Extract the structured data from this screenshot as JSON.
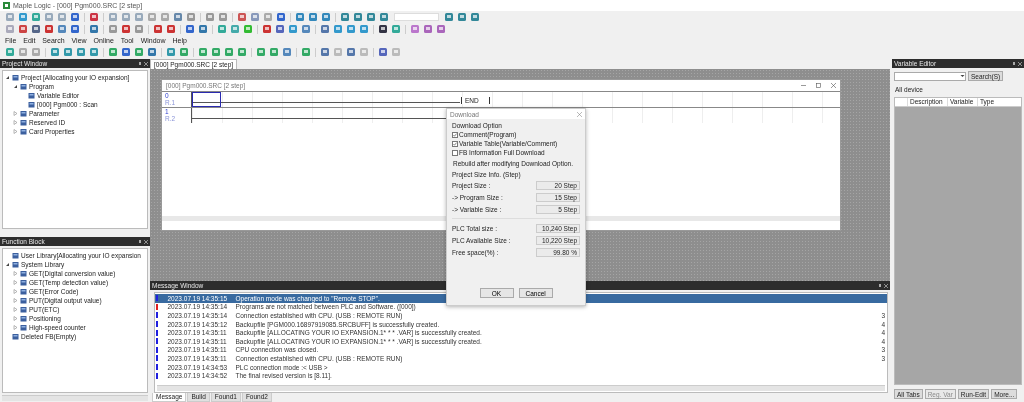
{
  "window": {
    "title": "Maple Logic - [000] Pgm000.SRC [2 step]"
  },
  "menu": [
    "File",
    "Edit",
    "Search",
    "View",
    "Online",
    "Tool",
    "Window",
    "Help"
  ],
  "project_window": {
    "title": "Project Window",
    "tree": [
      {
        "label": "Project [Allocating your IO expansion]",
        "expanded": true,
        "children": [
          {
            "label": "Program",
            "expanded": true,
            "children": [
              {
                "label": "Variable Editor"
              },
              {
                "label": "[000] Pgm000 : Scan"
              }
            ]
          },
          {
            "label": "Parameter",
            "expanded": false
          },
          {
            "label": "Reserved ID",
            "expanded": false
          },
          {
            "label": "Card Properties",
            "expanded": false
          }
        ]
      }
    ]
  },
  "function_block": {
    "title": "Function Block",
    "tree": [
      {
        "label": "User Library[Allocating your IO expansion"
      },
      {
        "label": "System Library",
        "expanded": true,
        "children": [
          {
            "label": "GET(Digital conversion value)",
            "expanded": false
          },
          {
            "label": "GET(Temp detection value)",
            "expanded": false
          },
          {
            "label": "GET(Error Code)",
            "expanded": false
          },
          {
            "label": "PUT(Digital output value)",
            "expanded": false
          },
          {
            "label": "PUT(ETC)",
            "expanded": false
          },
          {
            "label": "Positioning",
            "expanded": false
          },
          {
            "label": "High-speed counter",
            "expanded": false
          }
        ]
      },
      {
        "label": "Deleted FB(Empty)"
      }
    ]
  },
  "editor_tabs": [
    {
      "label": "[000] Pgm000.SRC [2 step]",
      "selected": true
    }
  ],
  "program_window": {
    "title": "[000] Pgm000.SRC [2 step]",
    "rungs": [
      {
        "step": "0",
        "label": "R.1"
      },
      {
        "step": "1",
        "label": "R.2"
      }
    ],
    "end_label": "END"
  },
  "download_dialog": {
    "title": "Download",
    "option_group": "Download Option",
    "options": [
      {
        "label": "Comment(Program)",
        "checked": true
      },
      {
        "label": "Variable Table(Variable/Comment)",
        "checked": true
      },
      {
        "label": "FB Information Full Download",
        "checked": false
      }
    ],
    "note": "Rebuild after modifying Download Option.",
    "size_group": "Project Size Info. (Step)",
    "sizes": [
      {
        "label": "Project Size :",
        "value": "20 Step"
      },
      {
        "label": "-> Program Size :",
        "value": "15 Step"
      },
      {
        "label": "-> Variable Size :",
        "value": "5 Step"
      }
    ],
    "plc_sizes": [
      {
        "label": "PLC Total size :",
        "value": "10,240 Step"
      },
      {
        "label": "PLC Available Size :",
        "value": "10,220 Step"
      },
      {
        "label": "Free space(%) :",
        "value": "99.80 %"
      }
    ],
    "buttons": [
      "OK",
      "Cancel"
    ]
  },
  "message_window": {
    "title": "Message Window",
    "messages": [
      {
        "time": "2023.07.19 14:35:15",
        "text": "Operation mode was changed to \"Remote STOP\".",
        "color": "#2020e0",
        "selected": true
      },
      {
        "time": "2023.07.19 14:35:14",
        "text": "Programs are not matched between PLC and Software. ([000])",
        "color": "#e02020",
        "selected": false
      },
      {
        "time": "2023.07.19 14:35:14",
        "text": "Connection established with CPU. (USB : REMOTE RUN)",
        "color": "#2020e0",
        "selected": false,
        "column_3": "3"
      },
      {
        "time": "2023.07.19 14:35:12",
        "text": "Backupfile [PGM000.16897919085.SRCBUFF] is successfully created.",
        "color": "#2020e0",
        "selected": false,
        "column_3": "4"
      },
      {
        "time": "2023.07.19 14:35:11",
        "text": "Backupfile [ALLOCATING YOUR IO EXPANSION.1* * * .VAR] is successfully created.",
        "color": "#2020e0",
        "selected": false,
        "column_3": "4"
      },
      {
        "time": "2023.07.19 14:35:11",
        "text": "Backupfile [ALLOCATING YOUR IO EXPANSION.1* * * .VAR] is successfully created.",
        "color": "#2020e0",
        "selected": false,
        "column_3": "4"
      },
      {
        "time": "2023.07.19 14:35:11",
        "text": "CPU connection was closed.",
        "color": "#2020e0",
        "selected": false,
        "column_3": "3"
      },
      {
        "time": "2023.07.19 14:35:11",
        "text": "Connection established with CPU. (USB : REMOTE RUN)",
        "color": "#2020e0",
        "selected": false,
        "column_3": "3"
      },
      {
        "time": "2023.07.19 14:34:53",
        "text": "PLC connection mode :< USB >",
        "color": "#2020e0",
        "selected": false
      },
      {
        "time": "2023.07.19 14:34:52",
        "text": "The final revised version is [8.11].",
        "color": "#2020e0",
        "selected": false
      }
    ],
    "tabs": [
      {
        "label": "Message",
        "selected": true
      },
      {
        "label": "Build",
        "selected": false
      },
      {
        "label": "Found1",
        "selected": false
      },
      {
        "label": "Found2",
        "selected": false
      }
    ]
  },
  "variable_editor": {
    "title": "Variable Editor",
    "search_button": "Search(S)",
    "device_tab": "All device",
    "columns": [
      "Description",
      "Variable",
      "Type"
    ],
    "buttons": [
      {
        "label": "All Tabs",
        "disabled": false
      },
      {
        "label": "Reg. Var",
        "disabled": true
      },
      {
        "label": "Run-Edit",
        "disabled": false
      },
      {
        "label": "More...",
        "disabled": false
      }
    ]
  }
}
